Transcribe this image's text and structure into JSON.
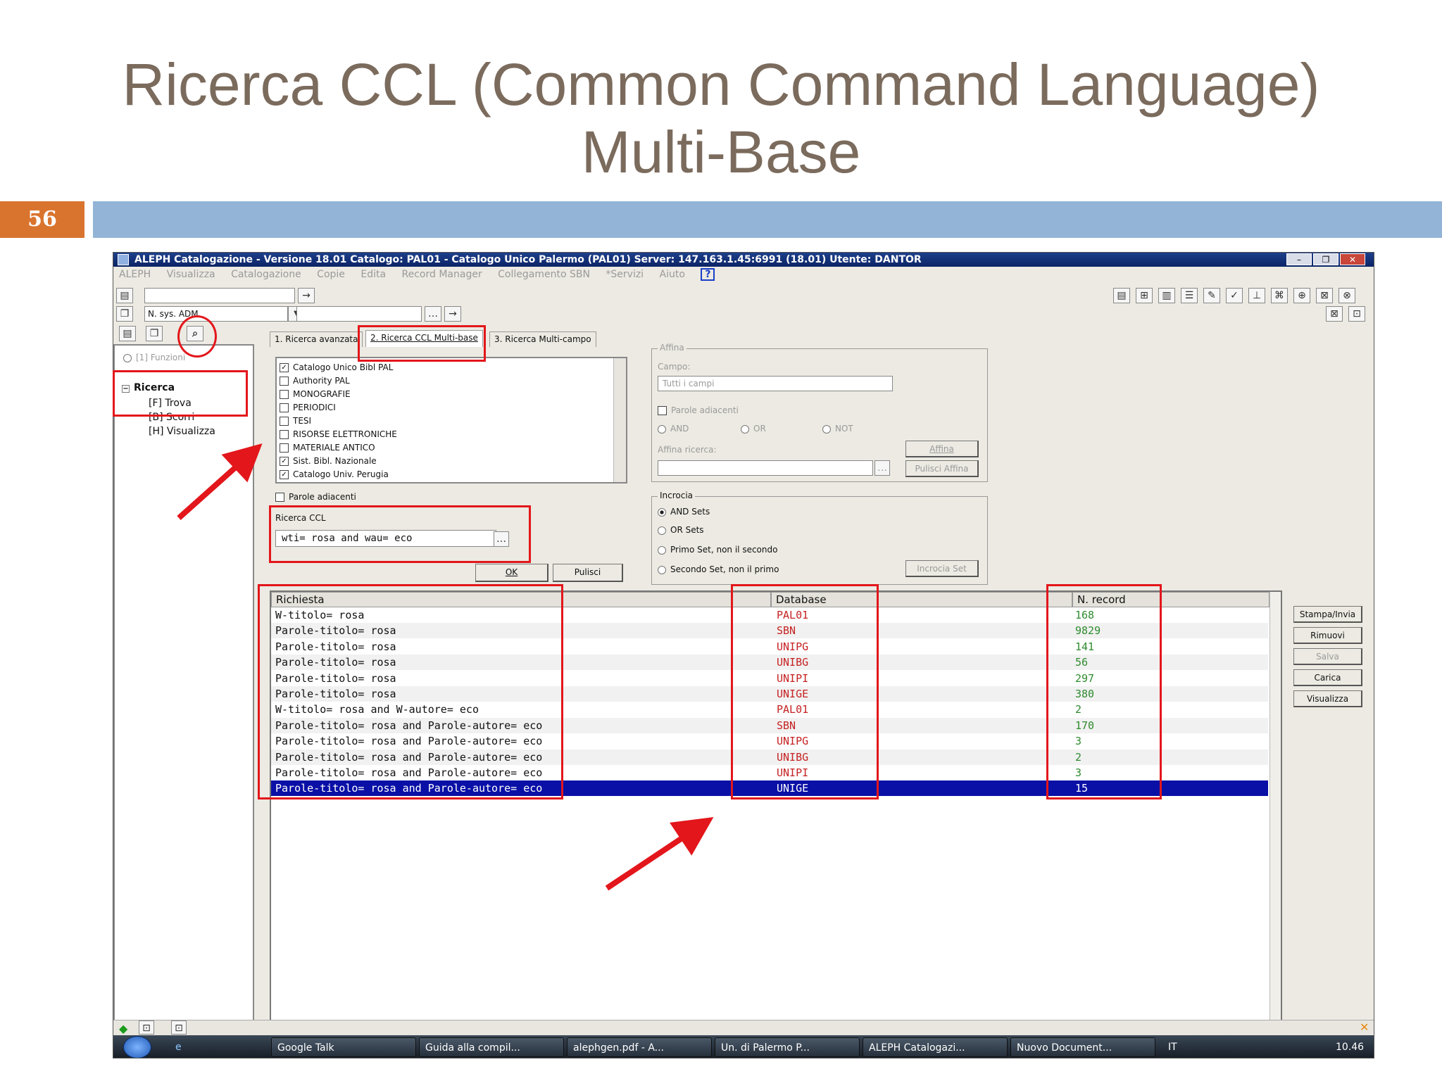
{
  "slide": {
    "title_line1": "Ricerca CCL (Common Command Language)",
    "title_line2": "Multi-Base",
    "page_number": "56"
  },
  "window": {
    "title": "ALEPH Catalogazione - Versione 18.01  Catalogo:  PAL01 - Catalogo Unico Palermo (PAL01)  Server:  147.163.1.45:6991 (18.01)  Utente:  DANTOR",
    "controls": [
      "–",
      "❐",
      "✕"
    ],
    "menu": [
      "ALEPH",
      "Visualizza",
      "Catalogazione",
      "Copie",
      "Edita",
      "Record Manager",
      "Collegamento SBN",
      "*Servizi",
      "Aiuto"
    ],
    "help_icon": "?",
    "sys_select": "N. sys. ADM",
    "ellipsis": "…"
  },
  "left_tree": {
    "radio1": "[1] Funzioni",
    "root": "Ricerca",
    "items": [
      "[F] Trova",
      "[B] Scorri",
      "[H] Visualizza"
    ]
  },
  "tabs": [
    "1. Ricerca avanzata",
    "2. Ricerca CCL Multi-base",
    "3. Ricerca Multi-campo"
  ],
  "databases": [
    {
      "label": "Catalogo Unico Bibl PAL",
      "checked": true
    },
    {
      "label": "Authority PAL",
      "checked": false
    },
    {
      "label": "MONOGRAFIE",
      "checked": false
    },
    {
      "label": "PERIODICI",
      "checked": false
    },
    {
      "label": "TESI",
      "checked": false
    },
    {
      "label": "RISORSE ELETTRONICHE",
      "checked": false
    },
    {
      "label": "MATERIALE ANTICO",
      "checked": false
    },
    {
      "label": "Sist. Bibl. Nazionale",
      "checked": true
    },
    {
      "label": "Catalogo Univ. Perugia",
      "checked": true
    }
  ],
  "parole_adiacenti": "Parole adiacenti",
  "ccl": {
    "label": "Ricerca CCL",
    "value": "wti= rosa and wau= eco",
    "ok": "OK",
    "clear": "Pulisci"
  },
  "affina": {
    "legend": "Affina",
    "campo_label": "Campo:",
    "campo_value": "Tutti i campi",
    "adiacenti": "Parole adiacenti",
    "ops": [
      "AND",
      "OR",
      "NOT"
    ],
    "affina_btn": "Affina",
    "ricerca_label": "Affina ricerca:",
    "pulisci_btn": "Pulisci Affina"
  },
  "incrocia": {
    "legend": "Incrocia",
    "options": [
      "AND Sets",
      "OR Sets",
      "Primo Set, non il secondo",
      "Secondo Set, non il primo"
    ],
    "button": "Incrocia Set"
  },
  "results": {
    "columns": [
      "Richiesta",
      "Database",
      "N. record"
    ],
    "rows": [
      {
        "q": "W-titolo= rosa",
        "db": "PAL01",
        "n": "168"
      },
      {
        "q": "Parole-titolo= rosa",
        "db": "SBN",
        "n": "9829"
      },
      {
        "q": "Parole-titolo= rosa",
        "db": "UNIPG",
        "n": "141"
      },
      {
        "q": "Parole-titolo= rosa",
        "db": "UNIBG",
        "n": "56"
      },
      {
        "q": "Parole-titolo= rosa",
        "db": "UNIPI",
        "n": "297"
      },
      {
        "q": "Parole-titolo= rosa",
        "db": "UNIGE",
        "n": "380"
      },
      {
        "q": "W-titolo= rosa and W-autore= eco",
        "db": "PAL01",
        "n": "2"
      },
      {
        "q": "Parole-titolo= rosa and Parole-autore= eco",
        "db": "SBN",
        "n": "170"
      },
      {
        "q": "Parole-titolo= rosa and Parole-autore= eco",
        "db": "UNIPG",
        "n": "3"
      },
      {
        "q": "Parole-titolo= rosa and Parole-autore= eco",
        "db": "UNIBG",
        "n": "2"
      },
      {
        "q": "Parole-titolo= rosa and Parole-autore= eco",
        "db": "UNIPI",
        "n": "3"
      },
      {
        "q": "Parole-titolo= rosa and Parole-autore= eco",
        "db": "UNIGE",
        "n": "15"
      }
    ],
    "selected_index": 11
  },
  "side_buttons": [
    "Stampa/Invia",
    "Rimuovi",
    "Salva",
    "Carica",
    "Visualizza"
  ],
  "taskbar": {
    "items": [
      "Google Talk",
      "Guida alla compil...",
      "alephgen.pdf - A...",
      "Un. di Palermo P...",
      "ALEPH Catalogazi...",
      "Nuovo Document..."
    ],
    "lang": "IT",
    "clock": "10.46"
  },
  "colors": {
    "accent_orange": "#d9742f",
    "slide_bar": "#93b4d6",
    "title_text": "#7b6b5d",
    "annotation_red": "#e3161b",
    "selection": "#0a10a6"
  }
}
